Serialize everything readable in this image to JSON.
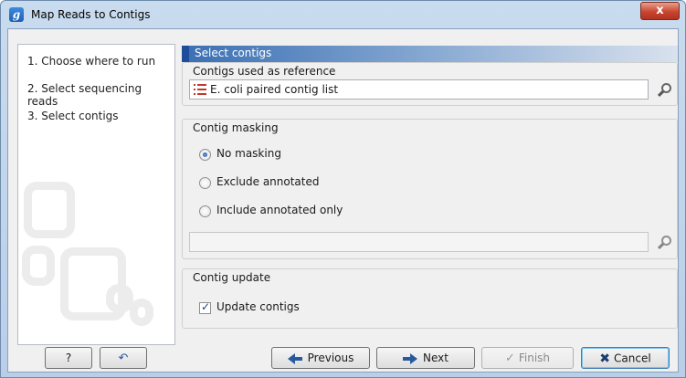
{
  "window": {
    "title": "Map Reads to Contigs",
    "app_icon_glyph": "g",
    "close_glyph": "x"
  },
  "steps": [
    {
      "label": "1.  Choose where to run"
    },
    {
      "label": "2.  Select sequencing reads"
    },
    {
      "label": "3.  Select contigs"
    }
  ],
  "panel": {
    "header": "Select contigs"
  },
  "reference": {
    "group_title": "Contigs used as reference",
    "value": "E. coli paired contig list",
    "icon": "list-icon",
    "browse_icon": "browse-icon"
  },
  "masking": {
    "group_title": "Contig masking",
    "options": [
      {
        "label": "No masking",
        "checked": true
      },
      {
        "label": "Exclude annotated",
        "checked": false
      },
      {
        "label": "Include annotated only",
        "checked": false
      }
    ],
    "annotation_value": ""
  },
  "update": {
    "group_title": "Contig update",
    "checkbox_label": "Update contigs",
    "checked": true,
    "check_glyph": "✓"
  },
  "buttons": {
    "help": "?",
    "reset_glyph": "↶",
    "previous": "Previous",
    "next": "Next",
    "finish": "Finish",
    "finish_glyph": "✓",
    "cancel": "Cancel",
    "cancel_glyph": "✖"
  },
  "colors": {
    "header_blue": "#3a6fb3",
    "list_icon_red": "#c2392b",
    "close_red": "#c9452e"
  }
}
